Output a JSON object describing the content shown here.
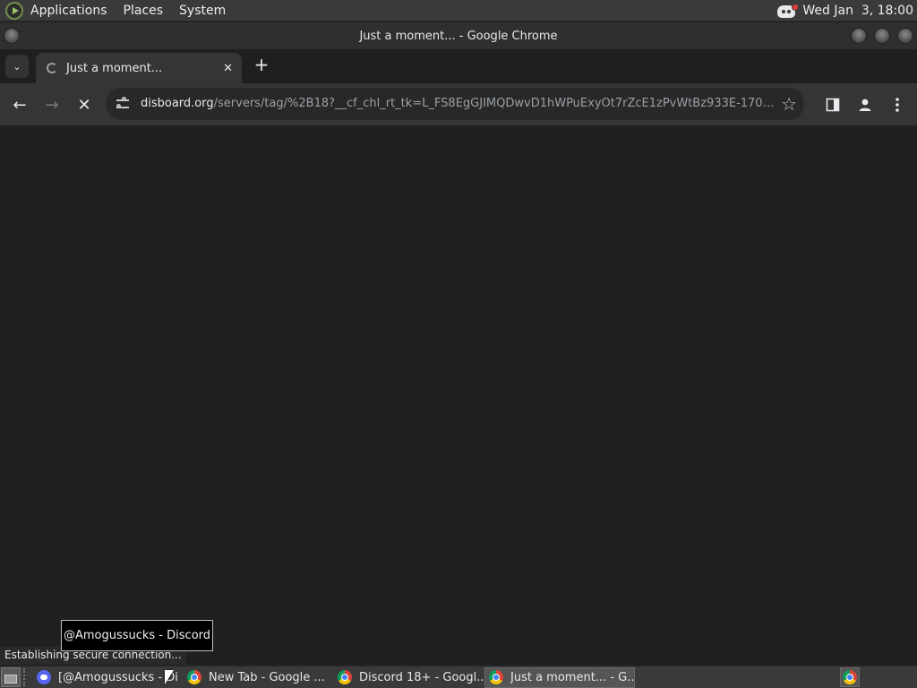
{
  "top_panel": {
    "menus": [
      "Applications",
      "Places",
      "System"
    ],
    "clock": "Wed Jan  3, 18:00"
  },
  "window": {
    "title": "Just a moment... - Google Chrome"
  },
  "browser": {
    "tab": {
      "title": "Just a moment...",
      "close_glyph": "✕"
    },
    "new_tab_glyph": "+",
    "tab_search_glyph": "⌄",
    "nav": {
      "back": "←",
      "forward": "→",
      "stop": "✕"
    },
    "url_host": "disboard.org",
    "url_rest": "/servers/tag/%2B18?__cf_chl_rt_tk=L_FS8EgGJIMQDwvD1hWPuExyOt7rZcE1zPvWtBz933E-17043...",
    "star_glyph": "☆",
    "status_text": "Establishing secure connection..."
  },
  "tooltip": "@Amogussucks - Discord",
  "taskbar": {
    "tasks": [
      {
        "label": "[@Amogussucks - Di",
        "icon": "discord-icon"
      },
      {
        "label": "New Tab - Google ...",
        "icon": "chrome-icon"
      },
      {
        "label": "Discord 18+ - Googl...",
        "icon": "chrome-icon"
      },
      {
        "label": "Just a moment... - G...",
        "icon": "chrome-icon"
      }
    ]
  }
}
